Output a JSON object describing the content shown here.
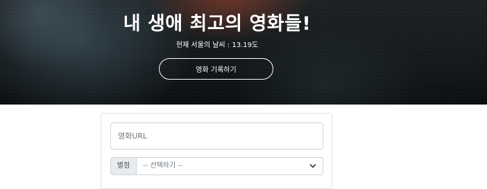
{
  "hero": {
    "title": "내 생애 최고의 영화들!",
    "weather_text": "현재 서울의 날씨 : 13.19도",
    "record_button_label": "영화 기록하기"
  },
  "form": {
    "url_input": {
      "placeholder": "영화URL",
      "value": ""
    },
    "rating": {
      "label": "별점",
      "selected": "-- 선택하기 --",
      "icon": "chevron-down-icon"
    }
  },
  "colors": {
    "hero_text": "#ffffff",
    "input_border": "#ced4da",
    "addon_background": "#e9ecef"
  }
}
